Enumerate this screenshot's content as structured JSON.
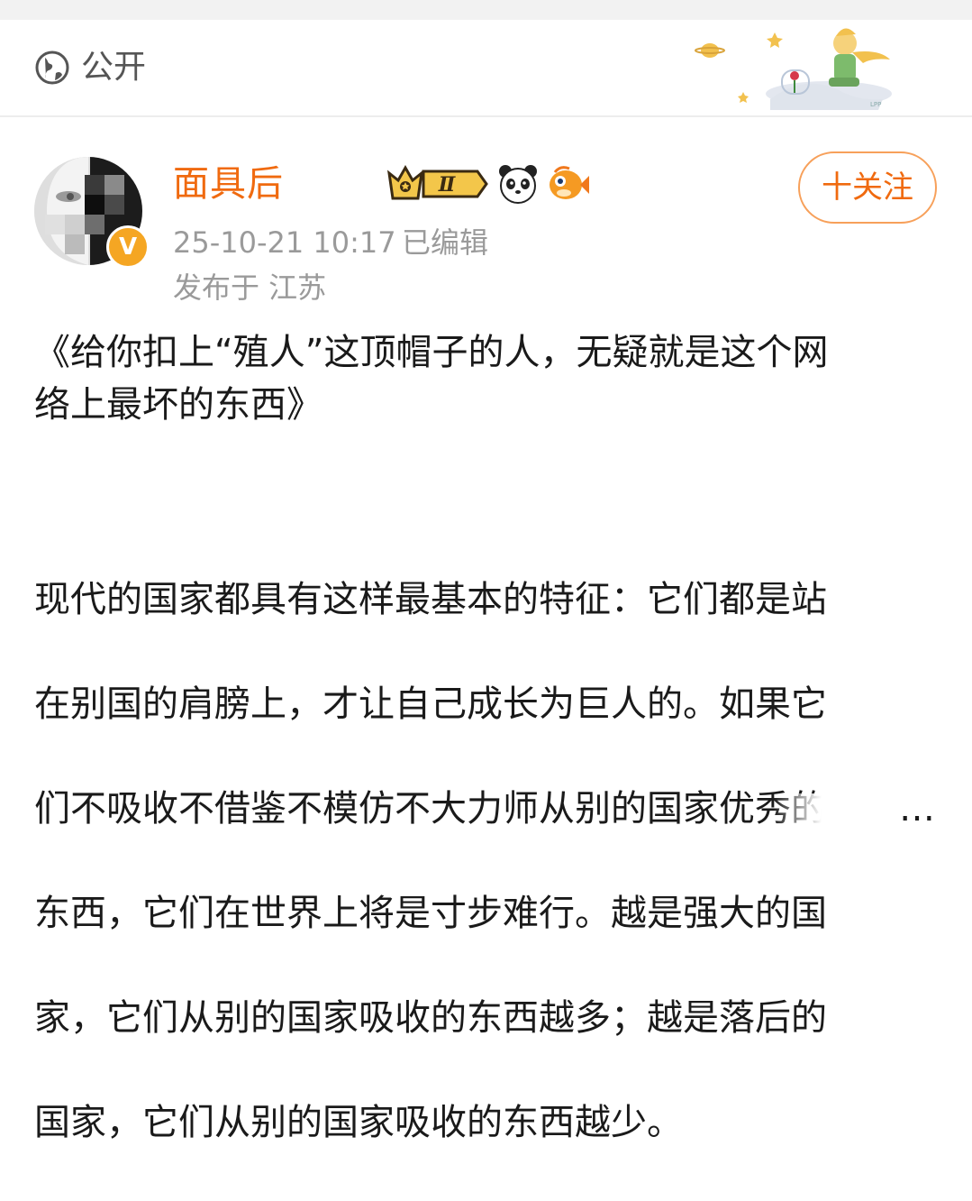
{
  "header": {
    "visibility_label": "公开"
  },
  "author": {
    "name": "面具后",
    "timestamp": "25-10-21 10:17",
    "edited_label": "已编辑",
    "location": "发布于 江苏",
    "level_badge": "Ⅱ",
    "verified_badge": "V"
  },
  "actions": {
    "follow_label": "十关注"
  },
  "post": {
    "title": "《给你扣上“殖人”这顶帽子的人，无疑就是这个网\n络上最坏的东西》",
    "lines": [
      "现代的国家都具有这样最基本的特征：它们都是站",
      "在别国的肩膀上，才让自己成长为巨人的。如果它",
      "们不吸收不借鉴不模仿不大力师从别的国家优秀的",
      "东西，它们在世界上将是寸步难行。越是强大的国",
      "家，它们从别的国家吸收的东西越多；越是落后的",
      "国家，它们从别的国家吸收的东西越少。"
    ],
    "more": "…"
  },
  "colors": {
    "accent": "#f06a0f",
    "follow_border": "#f7a05a",
    "meta_text": "#9a9a9a",
    "verified": "#f5a623"
  },
  "icons": [
    "globe-icon",
    "crown-level-icon",
    "panda-icon",
    "fish-icon",
    "verified-icon"
  ]
}
